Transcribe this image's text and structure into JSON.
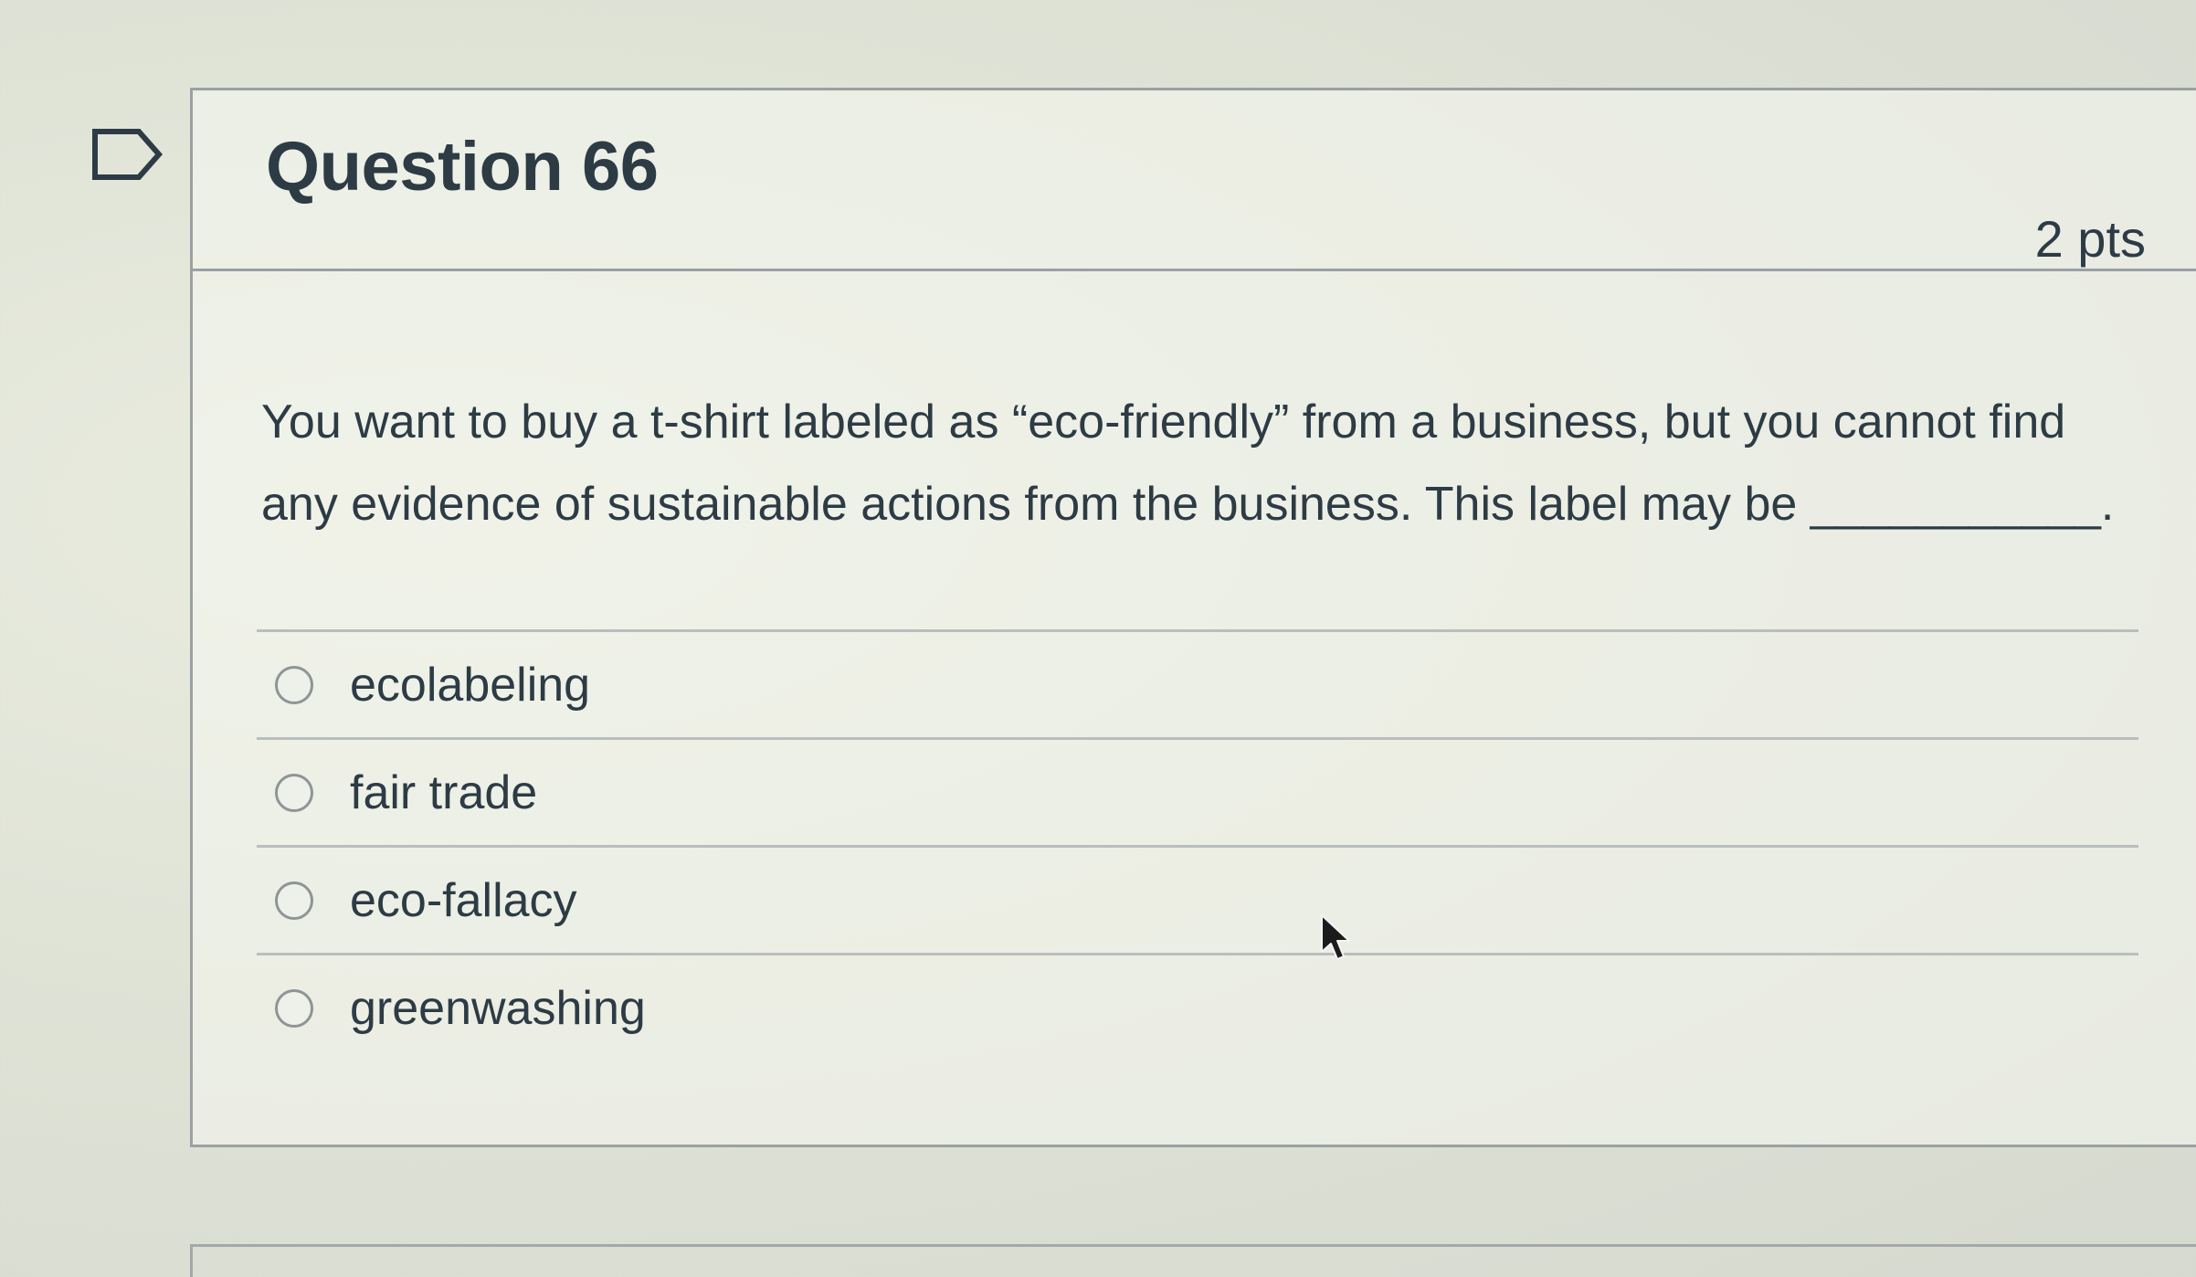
{
  "question": {
    "title": "Question 66",
    "points": "2 pts",
    "text": "You want to buy a t-shirt labeled as “eco-friendly” from a business, but you cannot find any evidence of sustainable actions from the business. This label may be ___________.",
    "flag_icon": "flag-outline-icon"
  },
  "answers": [
    {
      "label": "ecolabeling",
      "selected": false
    },
    {
      "label": "fair trade",
      "selected": false
    },
    {
      "label": "eco-fallacy",
      "selected": false
    },
    {
      "label": "greenwashing",
      "selected": false
    }
  ],
  "cursor_icon": "mouse-pointer-icon"
}
